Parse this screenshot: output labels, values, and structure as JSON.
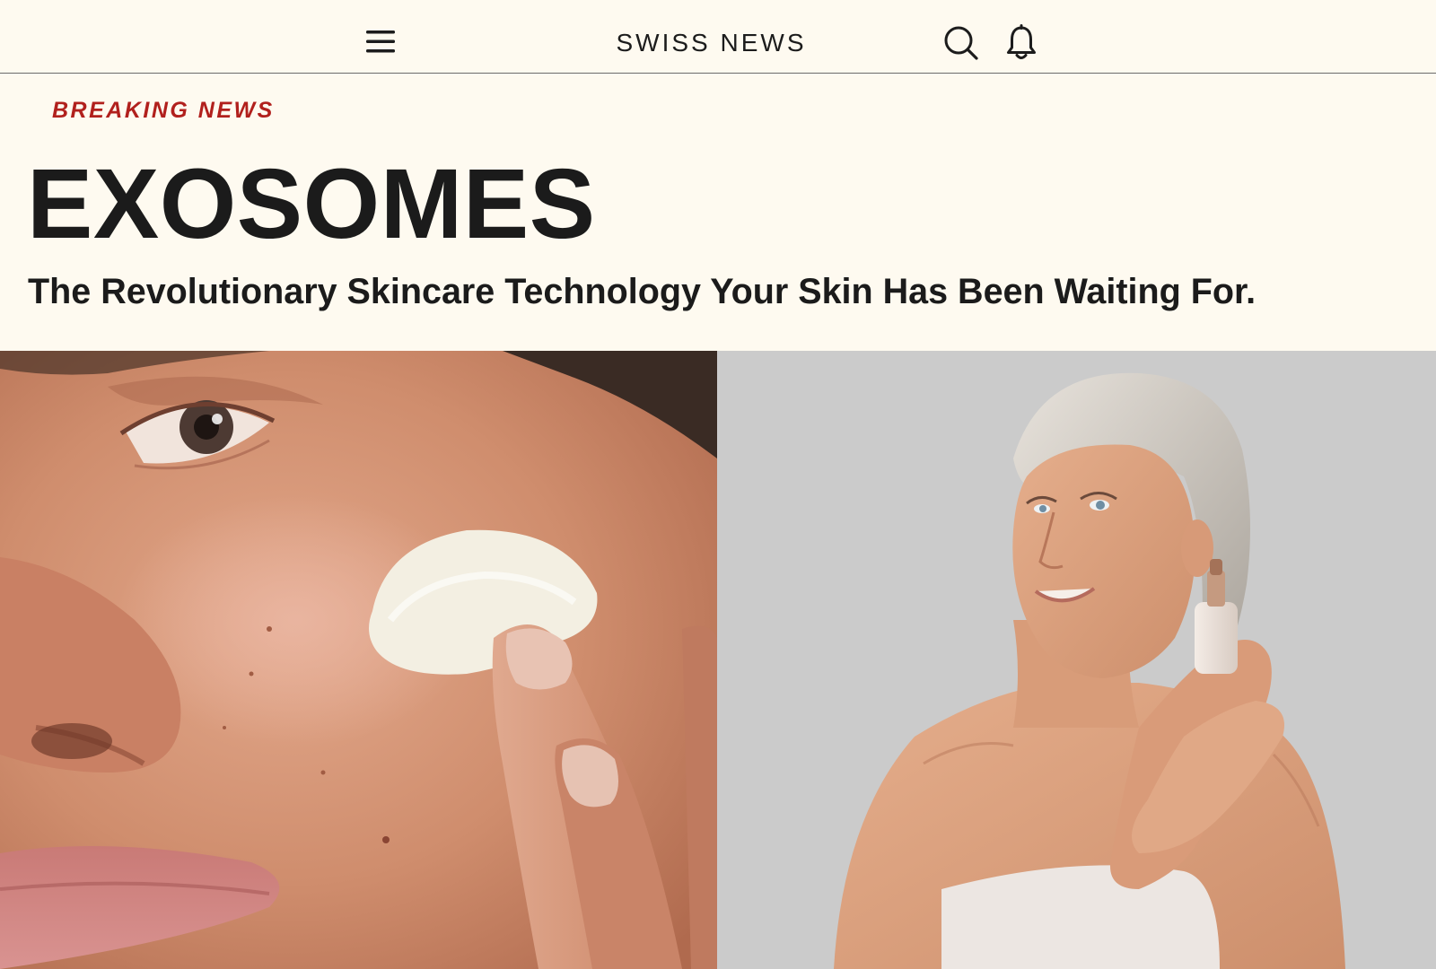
{
  "header": {
    "brand": "SWISS NEWS",
    "menu_icon": "hamburger-menu-icon",
    "search_icon": "search-icon",
    "notification_icon": "bell-icon"
  },
  "article": {
    "kicker": "BREAKING NEWS",
    "headline": "EXOSOMES",
    "subheadline": "The Revolutionary Skincare Technology Your Skin Has Been Waiting For."
  },
  "colors": {
    "background": "#fefaf0",
    "kicker": "#b1201d",
    "text": "#1b1b1b",
    "right_photo_background": "#cbcbcb"
  }
}
